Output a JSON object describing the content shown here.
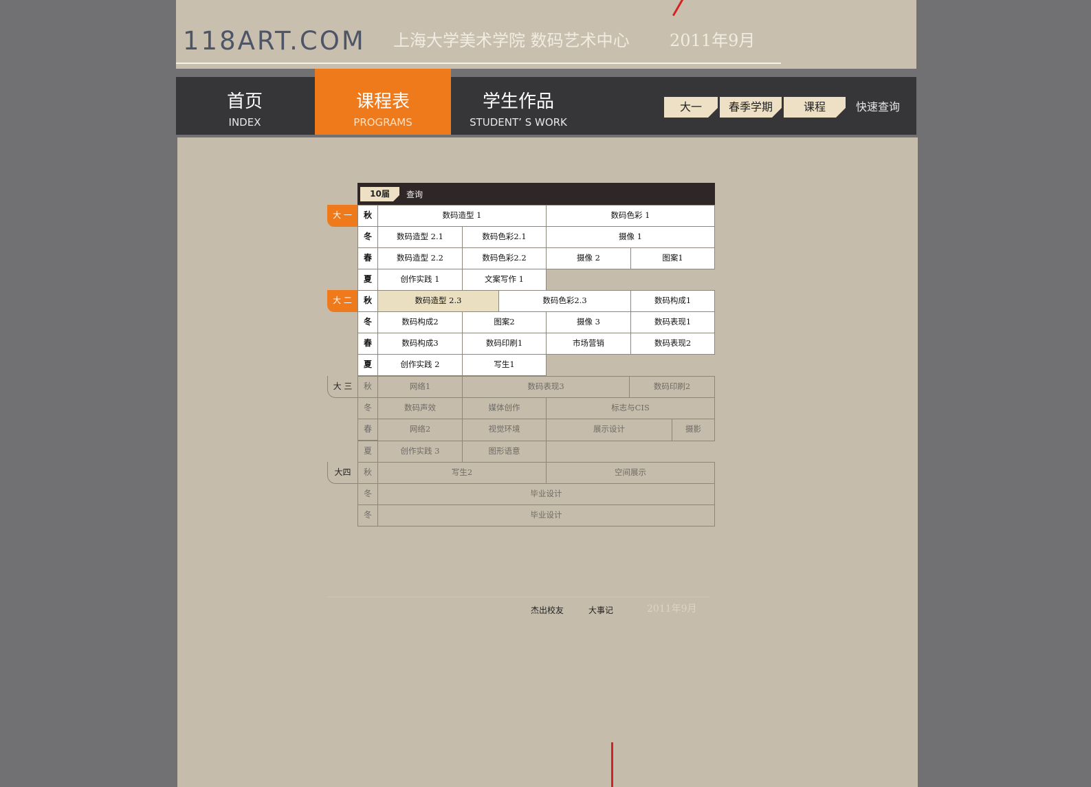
{
  "header": {
    "logo": "118ART.COM",
    "school": "上海大学美术学院  数码艺术中心",
    "date": "2011年9月"
  },
  "nav": {
    "items": [
      {
        "zh": "首页",
        "en": "INDEX"
      },
      {
        "zh": "课程表",
        "en": "PROGRAMS"
      },
      {
        "zh": "学生作品",
        "en": "STUDENT’ S WORK"
      }
    ],
    "chips": [
      "大一",
      "春季学期",
      "课程"
    ],
    "quick_search": "快速查询"
  },
  "table": {
    "cohort": "10届",
    "query_label": "查询",
    "years": [
      "大 一",
      "大 二",
      "大 三",
      "大四"
    ],
    "seasons": [
      "秋",
      "冬",
      "春",
      "夏",
      "秋",
      "冬",
      "春",
      "夏",
      "秋",
      "冬",
      "春",
      "夏",
      "秋",
      "冬",
      "冬"
    ],
    "cells": [
      "数码造型 1",
      "数码色彩 1",
      "数码造型 2.1",
      "数码色彩2.1",
      "摄像 1",
      "数码造型 2.2",
      "数码色彩2.2",
      "摄像 2",
      "图案1",
      "创作实践 1",
      "文案写作 1",
      "数码造型 2.3",
      "数码色彩2.3",
      "数码构成1",
      "数码构成2",
      "图案2",
      "摄像 3",
      "数码表现1",
      "数码构成3",
      "数码印刷1",
      "市场营销",
      "数码表现2",
      "创作实践 2",
      "写生1",
      "网络1",
      "数码表现3",
      "数码印刷2",
      "数码声效",
      "媒体创作",
      "标志与CIS",
      "网络2",
      "视觉环境",
      "展示设计",
      "摄影",
      "创作实践 3",
      "图形语意",
      "写生2",
      "空间展示",
      "毕业设计",
      "毕业设计"
    ]
  },
  "footer": {
    "links": [
      "杰出校友",
      "大事记"
    ],
    "date": "2011年9月"
  },
  "colors": {
    "accent": "#ef7a1c",
    "nav_bg": "#363537",
    "page_bg": "#c6bcab",
    "header_bg": "#c8bfae",
    "chip_bg": "#ede0c4"
  }
}
